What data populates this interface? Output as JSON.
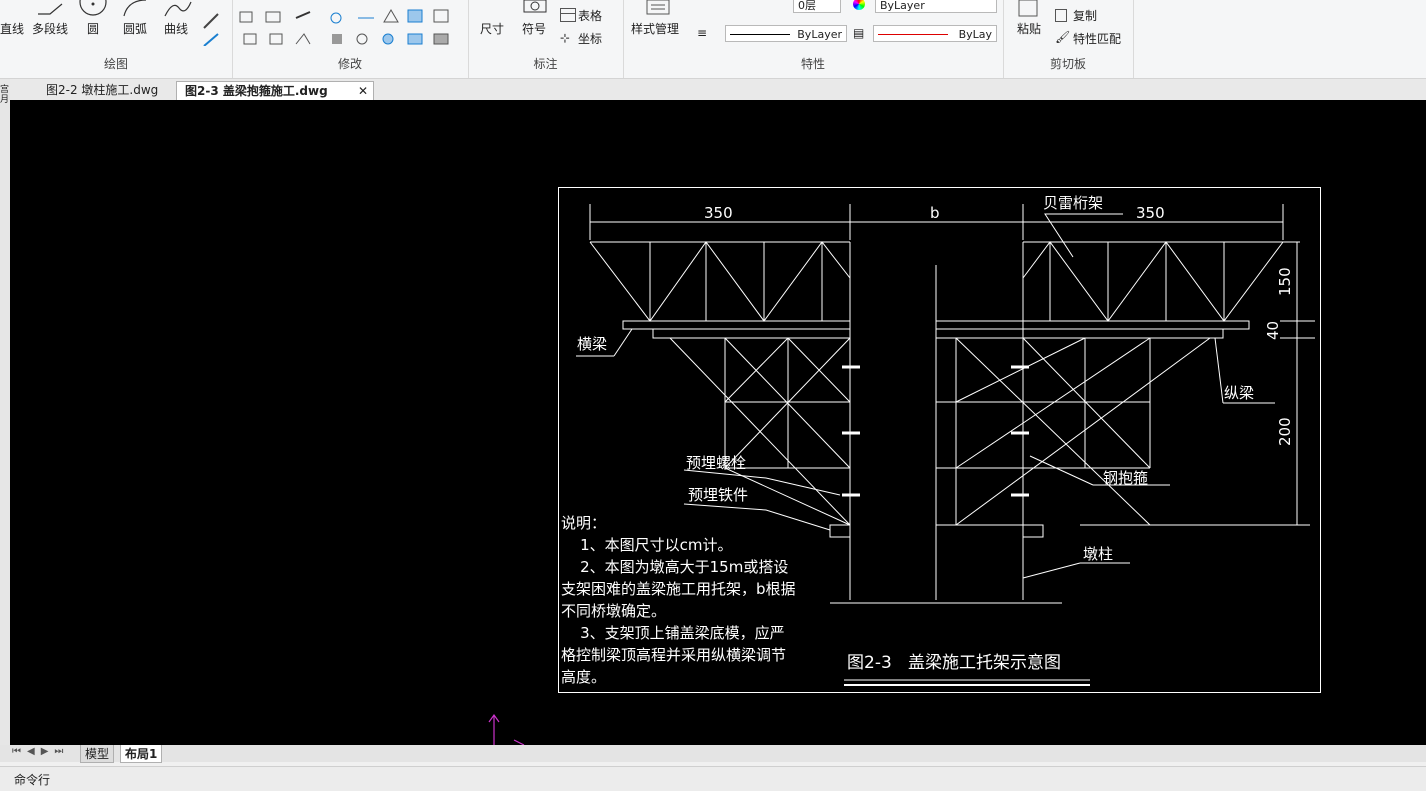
{
  "ribbon": {
    "draw": {
      "title": "绘图",
      "tools": [
        "直线",
        "多段线",
        "圆",
        "圆弧",
        "曲线"
      ]
    },
    "modify": {
      "title": "修改"
    },
    "annotate": {
      "title": "标注",
      "dimension": "尺寸",
      "symbol": "符号",
      "table": "表格",
      "coordinate": "坐标"
    },
    "properties": {
      "title": "特性",
      "style_manager": "样式管理",
      "layer_value": "0层",
      "color_value": "ByLayer",
      "linetype_value": "ByLayer",
      "lineweight_value": "ByLay"
    },
    "clipboard": {
      "title": "剪切板",
      "paste": "粘贴",
      "copy": "复制",
      "match_properties": "特性匹配"
    }
  },
  "doc_tabs": [
    {
      "label": "图2-2 墩柱施工.dwg",
      "active": false
    },
    {
      "label": "图2-3 盖梁抱箍施工.dwg",
      "active": true
    }
  ],
  "left_strip_label": "宫月",
  "drawing": {
    "dim_left": "350",
    "dim_mid": "b",
    "dim_right": "350",
    "dim_150": "150",
    "dim_40": "40",
    "dim_200": "200",
    "label_truss": "贝雷桁架",
    "label_crossbeam": "横梁",
    "label_longbeam": "纵梁",
    "label_bolt": "预埋螺栓",
    "label_iron": "预埋铁件",
    "label_hoop": "钢抱箍",
    "label_pier": "墩柱",
    "notes": [
      "说明：",
      "    1、本图尺寸以cm计。",
      "    2、本图为墩高大于15m或搭设",
      "支架困难的盖梁施工用托架，b根据",
      "不同桥墩确定。",
      "    3、支架顶上铺盖梁底模，应严",
      "格控制梁顶高程并采用纵横梁调节",
      "高度。"
    ],
    "caption": "图2-3   盖梁施工托架示意图"
  },
  "layout_tabs": [
    "模型",
    "布局1"
  ],
  "command_label": "命令行",
  "colors": {
    "canvas": "#000000",
    "lines": "#ffffff",
    "ucs": "#cc33cc"
  }
}
